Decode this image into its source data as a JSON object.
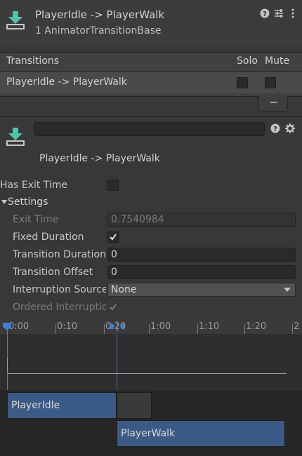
{
  "header": {
    "title": "PlayerIdle -> PlayerWalk",
    "subtitle": "1 AnimatorTransitionBase"
  },
  "transitions": {
    "heading": "Transitions",
    "solo_label": "Solo",
    "mute_label": "Mute",
    "rows": [
      {
        "label": "PlayerIdle -> PlayerWalk",
        "solo": false,
        "mute": false
      }
    ],
    "remove_label": "−"
  },
  "transition": {
    "name_value": "",
    "title": "PlayerIdle -> PlayerWalk"
  },
  "has_exit_time": {
    "label": "Has Exit Time",
    "checked": false
  },
  "settings": {
    "label": "Settings",
    "exit_time_label": "Exit Time",
    "exit_time_value": "0.7540984",
    "fixed_duration_label": "Fixed Duration",
    "fixed_duration_checked": true,
    "transition_duration_label": "Transition Duration",
    "transition_duration_value": "0",
    "transition_offset_label": "Transition Offset",
    "transition_offset_value": "0",
    "interruption_source_label": "Interruption Source",
    "interruption_source_value": "None",
    "ordered_interruption_label": "Ordered Interruption",
    "ordered_interruption_checked": true
  },
  "timeline": {
    "ticks": [
      "0:00",
      "0:10",
      "0:20",
      "1:00",
      "1:10",
      "1:20",
      "2"
    ],
    "source_state": "PlayerIdle",
    "dest_state": "PlayerWalk"
  },
  "colors": {
    "accent": "#3a5f8f",
    "bar": "#3b5a85"
  }
}
